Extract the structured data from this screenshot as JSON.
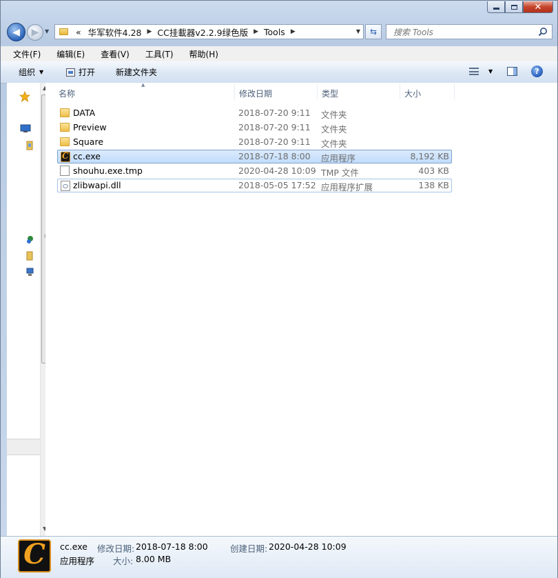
{
  "window": {
    "controls": {
      "minimize": "minimize",
      "maximize": "maximize",
      "close": "close"
    }
  },
  "address": {
    "overflow": "«",
    "crumbs": [
      "华军软件4.28",
      "CC挂載器v2.2.9绿色版",
      "Tools"
    ]
  },
  "search": {
    "placeholder": "搜索 Tools"
  },
  "menu": [
    "文件(F)",
    "编辑(E)",
    "查看(V)",
    "工具(T)",
    "帮助(H)"
  ],
  "toolbar": {
    "organize": "组织",
    "open": "打开",
    "new_folder": "新建文件夹",
    "help": "?"
  },
  "columns": {
    "name": "名称",
    "date": "修改日期",
    "type": "类型",
    "size": "大小"
  },
  "files": [
    {
      "name": "DATA",
      "date": "2018-07-20 9:11",
      "type": "文件夹",
      "size": "",
      "icon": "folder-icon"
    },
    {
      "name": "Preview",
      "date": "2018-07-20 9:11",
      "type": "文件夹",
      "size": "",
      "icon": "folder-icon"
    },
    {
      "name": "Square",
      "date": "2018-07-20 9:11",
      "type": "文件夹",
      "size": "",
      "icon": "folder-icon"
    },
    {
      "name": "cc.exe",
      "date": "2018-07-18 8:00",
      "type": "应用程序",
      "size": "8,192 KB",
      "icon": "app-icon",
      "selected": true
    },
    {
      "name": "shouhu.exe.tmp",
      "date": "2020-04-28 10:09",
      "type": "TMP 文件",
      "size": "403 KB",
      "icon": "document-icon"
    },
    {
      "name": "zlibwapi.dll",
      "date": "2018-05-05 17:52",
      "type": "应用程序扩展",
      "size": "138 KB",
      "icon": "dll-icon",
      "focused": true
    }
  ],
  "details": {
    "name": "cc.exe",
    "type": "应用程序",
    "modified_label": "修改日期:",
    "modified_value": "2018-07-18 8:00",
    "created_label": "创建日期:",
    "created_value": "2020-04-28 10:09",
    "size_label": "大小:",
    "size_value": "8.00 MB"
  },
  "colors": {
    "selection": "#cce4fc",
    "selection_border": "#7da2ce",
    "chrome": "#c9d8ec",
    "app_icon_accent": "#f0a020"
  }
}
